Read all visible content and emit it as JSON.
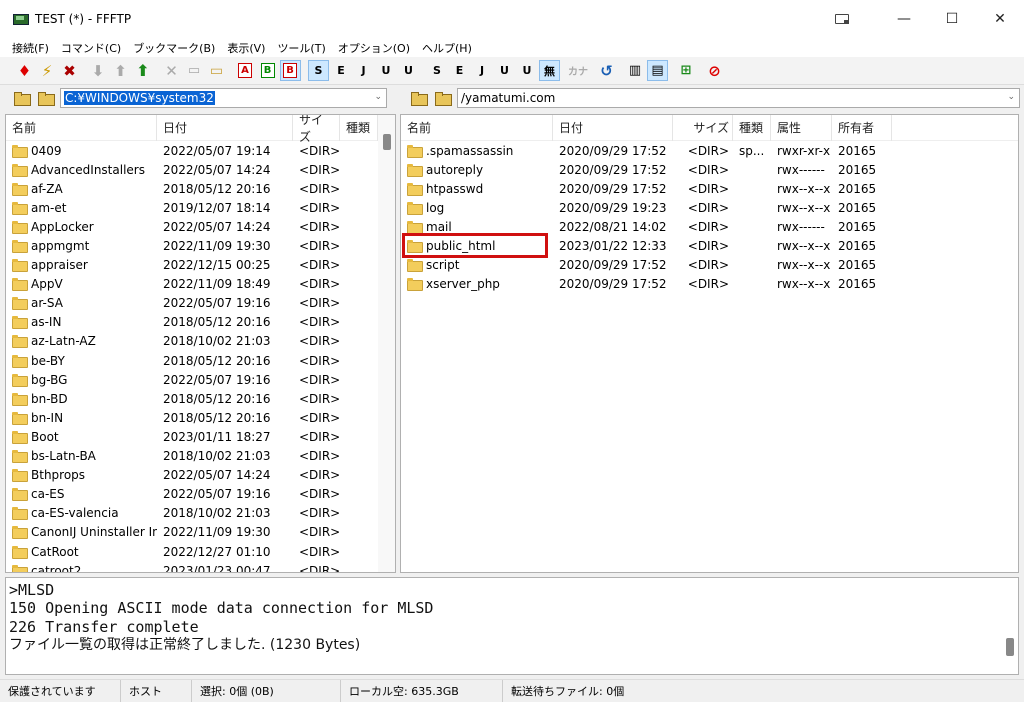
{
  "window": {
    "title": "TEST (*) - FFFTP"
  },
  "menu": [
    "接続(F)",
    "コマンド(C)",
    "ブックマーク(B)",
    "表示(V)",
    "ツール(T)",
    "オプション(O)",
    "ヘルプ(H)"
  ],
  "toolbar": {
    "labels": {
      "ascii": "A",
      "binary": "B",
      "auto": "B",
      "sjis": "S",
      "euc": "E",
      "jis": "J",
      "utf8": "U",
      "utf8bom": "U",
      "none": "無",
      "kana": "カナ"
    }
  },
  "local": {
    "path": "C:¥WINDOWS¥system32",
    "headers": {
      "name": "名前",
      "date": "日付",
      "size": "サイズ",
      "type": "種類"
    },
    "rows": [
      {
        "name": "0409",
        "date": "2022/05/07 19:14",
        "size": "<DIR>"
      },
      {
        "name": "AdvancedInstallers",
        "date": "2022/05/07 14:24",
        "size": "<DIR>"
      },
      {
        "name": "af-ZA",
        "date": "2018/05/12 20:16",
        "size": "<DIR>"
      },
      {
        "name": "am-et",
        "date": "2019/12/07 18:14",
        "size": "<DIR>"
      },
      {
        "name": "AppLocker",
        "date": "2022/05/07 14:24",
        "size": "<DIR>"
      },
      {
        "name": "appmgmt",
        "date": "2022/11/09 19:30",
        "size": "<DIR>"
      },
      {
        "name": "appraiser",
        "date": "2022/12/15 00:25",
        "size": "<DIR>"
      },
      {
        "name": "AppV",
        "date": "2022/11/09 18:49",
        "size": "<DIR>"
      },
      {
        "name": "ar-SA",
        "date": "2022/05/07 19:16",
        "size": "<DIR>"
      },
      {
        "name": "as-IN",
        "date": "2018/05/12 20:16",
        "size": "<DIR>"
      },
      {
        "name": "az-Latn-AZ",
        "date": "2018/10/02 21:03",
        "size": "<DIR>"
      },
      {
        "name": "be-BY",
        "date": "2018/05/12 20:16",
        "size": "<DIR>"
      },
      {
        "name": "bg-BG",
        "date": "2022/05/07 19:16",
        "size": "<DIR>"
      },
      {
        "name": "bn-BD",
        "date": "2018/05/12 20:16",
        "size": "<DIR>"
      },
      {
        "name": "bn-IN",
        "date": "2018/05/12 20:16",
        "size": "<DIR>"
      },
      {
        "name": "Boot",
        "date": "2023/01/11 18:27",
        "size": "<DIR>"
      },
      {
        "name": "bs-Latn-BA",
        "date": "2018/10/02 21:03",
        "size": "<DIR>"
      },
      {
        "name": "Bthprops",
        "date": "2022/05/07 14:24",
        "size": "<DIR>"
      },
      {
        "name": "ca-ES",
        "date": "2022/05/07 19:16",
        "size": "<DIR>"
      },
      {
        "name": "ca-ES-valencia",
        "date": "2018/10/02 21:03",
        "size": "<DIR>"
      },
      {
        "name": "CanonIJ Uninstaller Inf...",
        "date": "2022/11/09 19:30",
        "size": "<DIR>"
      },
      {
        "name": "CatRoot",
        "date": "2022/12/27 01:10",
        "size": "<DIR>"
      },
      {
        "name": "catroot2",
        "date": "2023/01/23 00:47",
        "size": "<DIR>"
      }
    ]
  },
  "remote": {
    "path": "/yamatumi.com",
    "headers": {
      "name": "名前",
      "date": "日付",
      "size": "サイズ",
      "type": "種類",
      "attr": "属性",
      "owner": "所有者"
    },
    "rows": [
      {
        "name": ".spamassassin",
        "date": "2020/09/29 17:52",
        "size": "<DIR>",
        "type": "sp...",
        "attr": "rwxr-xr-x",
        "owner": "20165"
      },
      {
        "name": "autoreply",
        "date": "2020/09/29 17:52",
        "size": "<DIR>",
        "type": "",
        "attr": "rwx------",
        "owner": "20165"
      },
      {
        "name": "htpasswd",
        "date": "2020/09/29 17:52",
        "size": "<DIR>",
        "type": "",
        "attr": "rwx--x--x",
        "owner": "20165"
      },
      {
        "name": "log",
        "date": "2020/09/29 19:23",
        "size": "<DIR>",
        "type": "",
        "attr": "rwx--x--x",
        "owner": "20165"
      },
      {
        "name": "mail",
        "date": "2022/08/21 14:02",
        "size": "<DIR>",
        "type": "",
        "attr": "rwx------",
        "owner": "20165"
      },
      {
        "name": "public_html",
        "date": "2023/01/22 12:33",
        "size": "<DIR>",
        "type": "",
        "attr": "rwx--x--x",
        "owner": "20165"
      },
      {
        "name": "script",
        "date": "2020/09/29 17:52",
        "size": "<DIR>",
        "type": "",
        "attr": "rwx--x--x",
        "owner": "20165"
      },
      {
        "name": "xserver_php",
        "date": "2020/09/29 17:52",
        "size": "<DIR>",
        "type": "",
        "attr": "rwx--x--x",
        "owner": "20165"
      }
    ]
  },
  "log": [
    ">MLSD",
    "150 Opening ASCII mode data connection for MLSD",
    "226 Transfer complete",
    "ファイル一覧の取得は正常終了しました. (1230 Bytes)"
  ],
  "status": {
    "protected": "保護されています",
    "host": "ホスト",
    "selection": "選択: 0個 (0B)",
    "local_free": "ローカル空: 635.3GB",
    "queue": "転送待ちファイル: 0個"
  },
  "colors": {
    "highlight": "#d01010",
    "selection": "#0a64d4"
  }
}
